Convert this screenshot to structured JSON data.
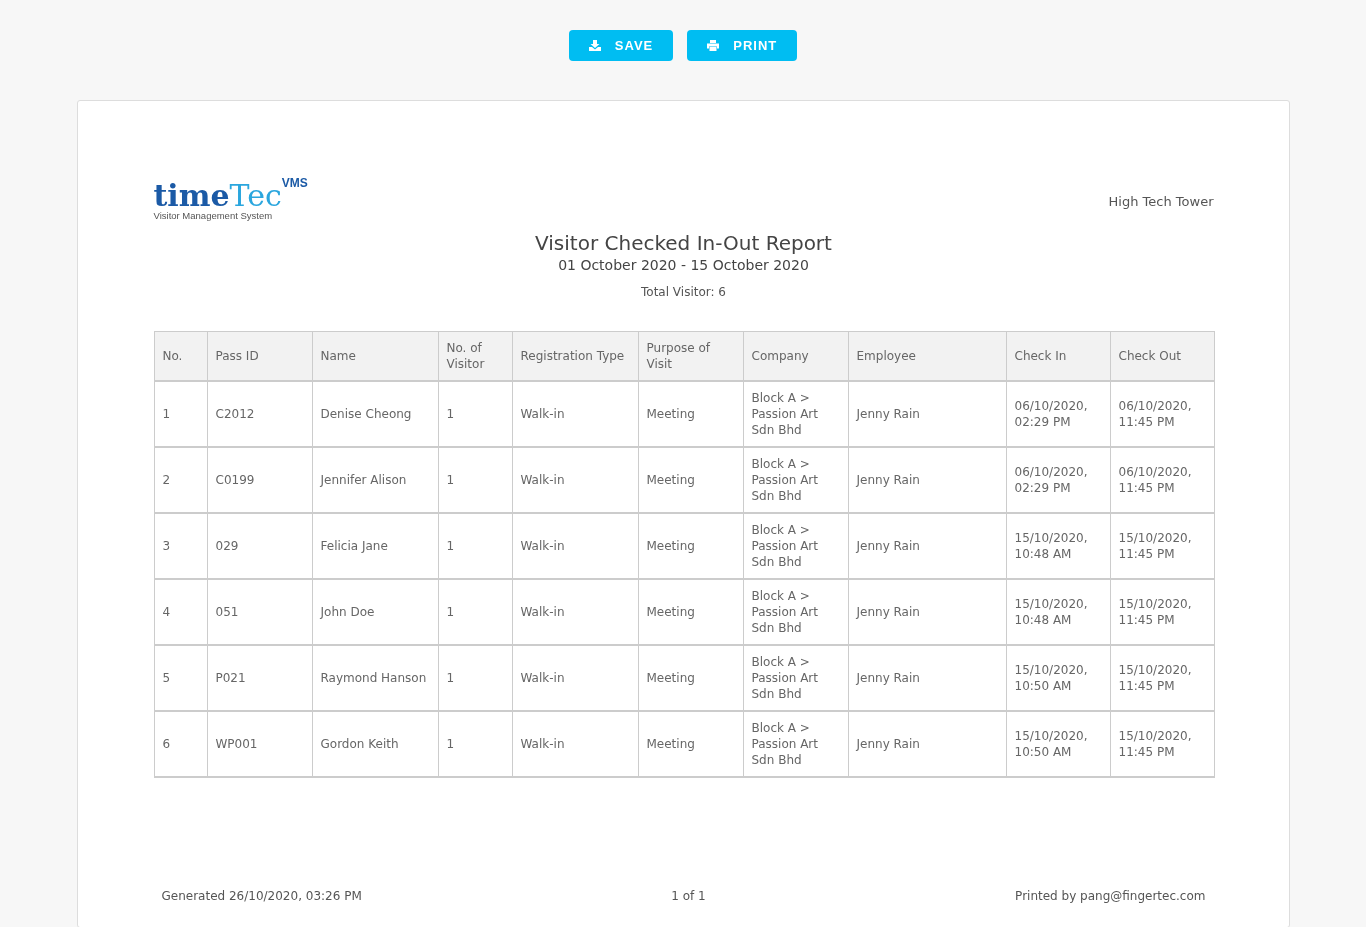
{
  "toolbar": {
    "buttons": [
      {
        "kind": "save",
        "label": "SAVE"
      },
      {
        "kind": "print",
        "label": "PRINT"
      }
    ]
  },
  "report": {
    "logo": {
      "word_1": "time",
      "word_2": "Tec",
      "badge": "VMS",
      "tagline": "Visitor Management System"
    },
    "site": "High Tech Tower",
    "title": "Visitor Checked In-Out Report",
    "period": "01 October 2020 - 15 October 2020",
    "total": "Total Visitor: 6",
    "table": {
      "columns": [
        "No.",
        "Pass ID",
        "Name",
        "No. of Visitor",
        "Registration Type",
        "Purpose of Visit",
        "Company",
        "Employee",
        "Check In",
        "Check Out"
      ],
      "rows": [
        [
          "1",
          "C2012",
          "Denise Cheong",
          "1",
          "Walk-in",
          "Meeting",
          "Block A > Passion Art Sdn Bhd",
          "Jenny Rain",
          "06/10/2020, 02:29 PM",
          "06/10/2020, 11:45 PM"
        ],
        [
          "2",
          "C0199",
          "Jennifer Alison",
          "1",
          "Walk-in",
          "Meeting",
          "Block A > Passion Art Sdn Bhd",
          "Jenny Rain",
          "06/10/2020, 02:29 PM",
          "06/10/2020, 11:45 PM"
        ],
        [
          "3",
          "029",
          "Felicia Jane",
          "1",
          "Walk-in",
          "Meeting",
          "Block A > Passion Art Sdn Bhd",
          "Jenny Rain",
          "15/10/2020, 10:48 AM",
          "15/10/2020, 11:45 PM"
        ],
        [
          "4",
          "051",
          "John Doe",
          "1",
          "Walk-in",
          "Meeting",
          "Block A > Passion Art Sdn Bhd",
          "Jenny Rain",
          "15/10/2020, 10:48 AM",
          "15/10/2020, 11:45 PM"
        ],
        [
          "5",
          "P021",
          "Raymond Hanson",
          "1",
          "Walk-in",
          "Meeting",
          "Block A > Passion Art Sdn Bhd",
          "Jenny Rain",
          "15/10/2020, 10:50 AM",
          "15/10/2020, 11:45 PM"
        ],
        [
          "6",
          "WP001",
          "Gordon Keith",
          "1",
          "Walk-in",
          "Meeting",
          "Block A > Passion Art Sdn Bhd",
          "Jenny Rain",
          "15/10/2020, 10:50 AM",
          "15/10/2020, 11:45 PM"
        ]
      ]
    },
    "footer": {
      "generated": "Generated 26/10/2020, 03:26 PM",
      "page": "1 of 1",
      "printed_by": "Printed by pang@fingertec.com"
    }
  }
}
